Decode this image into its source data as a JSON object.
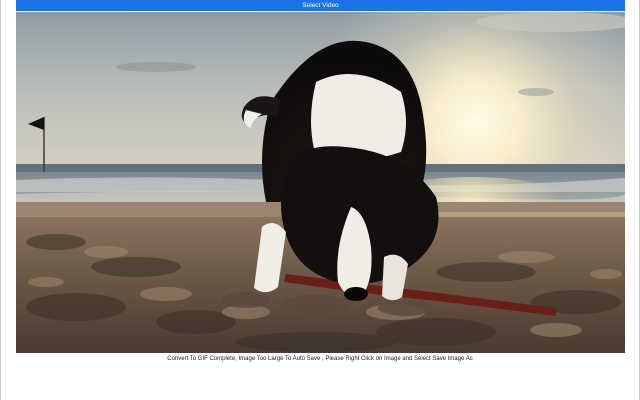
{
  "toolbar": {
    "select_video_label": "Select Video"
  },
  "preview": {
    "subject": "puppy-digging-on-beach",
    "accent": "#1a73e8"
  },
  "status": {
    "message": "Convert To GIF Complete, Image Too Large To Auto Save , Please Right Click on Image and Select Save Image As"
  }
}
